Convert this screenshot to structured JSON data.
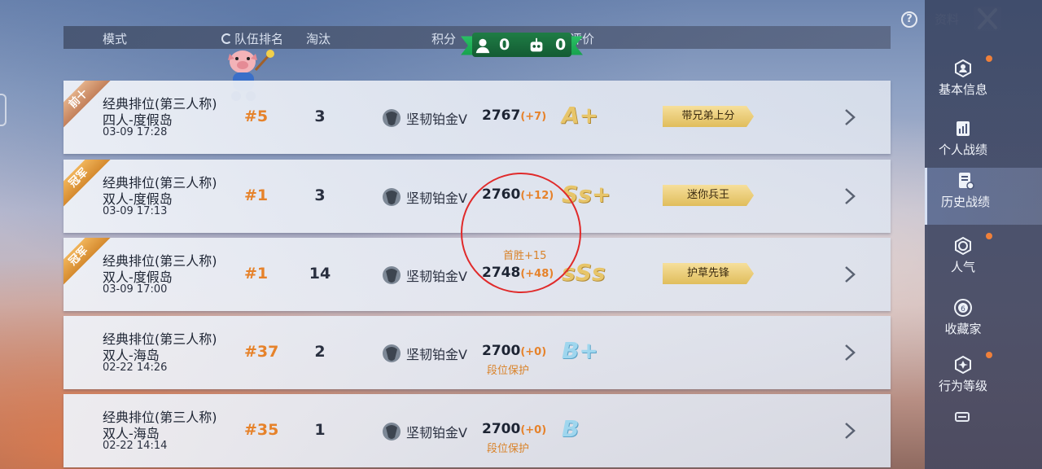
{
  "header": {
    "mode": "模式",
    "team_rank": "队伍排名",
    "kills": "淘汰",
    "score": "积分",
    "evaluation": "评价"
  },
  "ribbon": {
    "humans_count": "0",
    "bots_count": "0"
  },
  "top": {
    "label": "资料"
  },
  "rows": [
    {
      "badge": "前十",
      "mode": "经典排位(第三人称)",
      "map": "四人-度假岛",
      "time": "03-09 17:28",
      "rank": "#5",
      "kills": "3",
      "tier": "坚韧铂金Ⅴ",
      "score": "2767",
      "delta": "(+7)",
      "note": "",
      "eval": "A+",
      "title": "带兄弟上分"
    },
    {
      "badge": "冠军",
      "mode": "经典排位(第三人称)",
      "map": "双人-度假岛",
      "time": "03-09 17:13",
      "rank": "#1",
      "kills": "3",
      "tier": "坚韧铂金Ⅴ",
      "score": "2760",
      "delta": "(+12)",
      "note": "",
      "eval": "Ss+",
      "title": "迷你兵王"
    },
    {
      "badge": "冠军",
      "mode": "经典排位(第三人称)",
      "map": "双人-度假岛",
      "time": "03-09 17:00",
      "rank": "#1",
      "kills": "14",
      "tier": "坚韧铂金Ⅴ",
      "score": "2748",
      "delta": "(+48)",
      "note": "",
      "eval": "sSs",
      "title": "护草先锋"
    },
    {
      "badge": "",
      "mode": "经典排位(第三人称)",
      "map": "双人-海岛",
      "time": "02-22 14:26",
      "rank": "#37",
      "kills": "2",
      "tier": "坚韧铂金Ⅴ",
      "score": "2700",
      "delta": "(+0)",
      "note": "段位保护",
      "eval": "B+",
      "title": ""
    },
    {
      "badge": "",
      "mode": "经典排位(第三人称)",
      "map": "双人-海岛",
      "time": "02-22 14:14",
      "rank": "#35",
      "kills": "1",
      "tier": "坚韧铂金Ⅴ",
      "score": "2700",
      "delta": "(+0)",
      "note": "段位保护",
      "eval": "B",
      "title": ""
    }
  ],
  "first_win_note": "首胜+15",
  "sidebar": {
    "items": [
      {
        "label": "基本信息",
        "icon": "profile-icon",
        "dot": true
      },
      {
        "label": "个人战绩",
        "icon": "stats-icon",
        "dot": false
      },
      {
        "label": "历史战绩",
        "icon": "history-icon",
        "dot": false,
        "active": true
      },
      {
        "label": "人气",
        "icon": "popularity-icon",
        "dot": true
      },
      {
        "label": "收藏家",
        "icon": "collector-icon",
        "dot": false
      },
      {
        "label": "行为等级",
        "icon": "behavior-icon",
        "dot": true
      }
    ]
  },
  "colors": {
    "accent_orange": "#e6822a",
    "ribbon_green": "#2fc86a",
    "highlight_circle": "#e02a2a"
  }
}
